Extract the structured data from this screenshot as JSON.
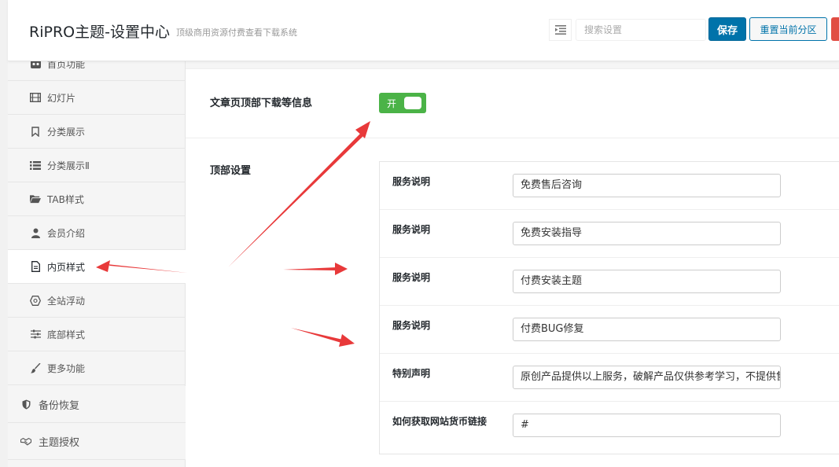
{
  "header": {
    "title": "RiPRO主题-设置中心",
    "subtitle": "顶级商用资源付费查看下载系统",
    "search_placeholder": "搜索设置",
    "save_label": "保存",
    "reset_label": "重置当前分区"
  },
  "sidebar": {
    "items": [
      {
        "label": "首页功能",
        "icon": "grid-icon"
      },
      {
        "label": "幻灯片",
        "icon": "film-icon"
      },
      {
        "label": "分类展示",
        "icon": "bookmark-icon"
      },
      {
        "label": "分类展示Ⅱ",
        "icon": "list-icon"
      },
      {
        "label": "TAB样式",
        "icon": "folder-icon"
      },
      {
        "label": "会员介绍",
        "icon": "user-icon"
      },
      {
        "label": "内页样式",
        "icon": "file-icon",
        "active": true
      },
      {
        "label": "全站浮动",
        "icon": "hexagon-icon"
      },
      {
        "label": "底部样式",
        "icon": "sliders-icon"
      },
      {
        "label": "更多功能",
        "icon": "brush-icon"
      }
    ],
    "top_items": [
      {
        "label": "备份恢复",
        "icon": "shield-icon"
      },
      {
        "label": "主题授权",
        "icon": "handshake-icon"
      }
    ]
  },
  "main": {
    "toggle_row": {
      "label": "文章页顶部下载等信息",
      "toggle_text": "开",
      "value": true
    },
    "group": {
      "label": "顶部设置",
      "fields": [
        {
          "label": "服务说明",
          "value": "免费售后咨询"
        },
        {
          "label": "服务说明",
          "value": "免费安装指导"
        },
        {
          "label": "服务说明",
          "value": "付费安装主题"
        },
        {
          "label": "服务说明",
          "value": "付费BUG修复"
        },
        {
          "label": "特别声明",
          "value": "原创产品提供以上服务，破解产品仅供参考学习，不提供售后服务"
        },
        {
          "label": "如何获取网站货币链接",
          "value": "#"
        }
      ]
    }
  },
  "colors": {
    "primary": "#0073aa",
    "toggle_on": "#4bb347",
    "annotation_arrow": "#e8393a"
  }
}
